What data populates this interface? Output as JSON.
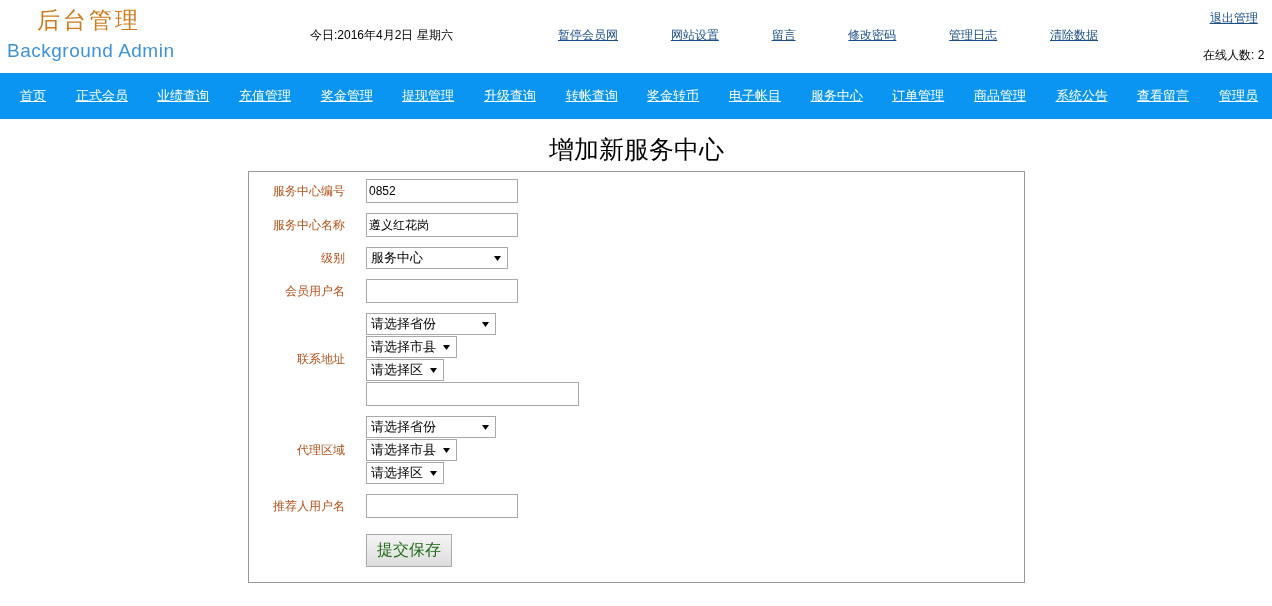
{
  "logo": {
    "title": "后台管理",
    "subtitle": "Background Admin"
  },
  "date": "今日:2016年4月2日 星期六",
  "top_links": [
    "暂停会员网",
    "网站设置",
    "留言",
    "修改密码",
    "管理日志",
    "清除数据"
  ],
  "logout": "退出管理",
  "online": "在线人数: 2",
  "nav": [
    "首页",
    "正式会员",
    "业绩查询",
    "充值管理",
    "奖金管理",
    "提现管理",
    "升级查询",
    "转帐查询",
    "奖金转币",
    "电子帐目",
    "服务中心",
    "订单管理",
    "商品管理",
    "系统公告",
    "查看留言",
    "管理员"
  ],
  "page_title": "增加新服务中心",
  "form": [
    {
      "label": "服务中心编号",
      "controls": [
        {
          "kind": "input",
          "value": "0852"
        }
      ]
    },
    {
      "label": "服务中心名称",
      "controls": [
        {
          "kind": "input",
          "value": "遵义红花岗"
        }
      ]
    },
    {
      "label": "级别",
      "controls": [
        {
          "kind": "select",
          "value": "服务中心"
        }
      ]
    },
    {
      "label": "会员用户名",
      "controls": [
        {
          "kind": "input"
        }
      ]
    },
    {
      "label": "联系地址",
      "controls": [
        {
          "kind": "select",
          "value": "请选择省份"
        },
        {
          "kind": "select",
          "value": "请选择市县"
        },
        {
          "kind": "select",
          "value": "请选择区"
        },
        {
          "kind": "wideinput"
        }
      ]
    },
    {
      "label": "代理区域",
      "controls": [
        {
          "kind": "select",
          "value": "请选择省份"
        },
        {
          "kind": "select",
          "value": "请选择市县"
        },
        {
          "kind": "select",
          "value": "请选择区"
        }
      ]
    },
    {
      "label": "推荐人用户名",
      "controls": [
        {
          "kind": "input"
        }
      ]
    }
  ],
  "submit": "提交保存"
}
